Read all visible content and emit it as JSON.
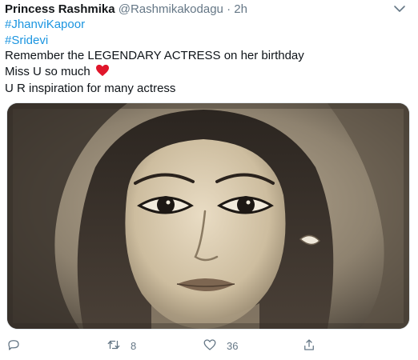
{
  "tweet": {
    "author_name": "Princess Rashmika",
    "author_handle": "@Rashmikakodagu",
    "separator": "·",
    "time": "2h",
    "hashtags": [
      "#JhanviKapoor",
      "#Sridevi"
    ],
    "text_lines": [
      "Remember the LEGENDARY ACTRESS on her birthday",
      "Miss U so much",
      "U R inspiration for many actress"
    ],
    "retweet_count": "8",
    "like_count": "36"
  },
  "icons": {
    "more": "chevron-down-icon",
    "reply": "reply-icon",
    "retweet": "retweet-icon",
    "like": "heart-icon",
    "share": "share-icon",
    "emoji": "red-heart-emoji"
  },
  "colors": {
    "hashtag": "#1b95e0",
    "muted": "#657786",
    "heart_emoji": "#e0162b"
  }
}
